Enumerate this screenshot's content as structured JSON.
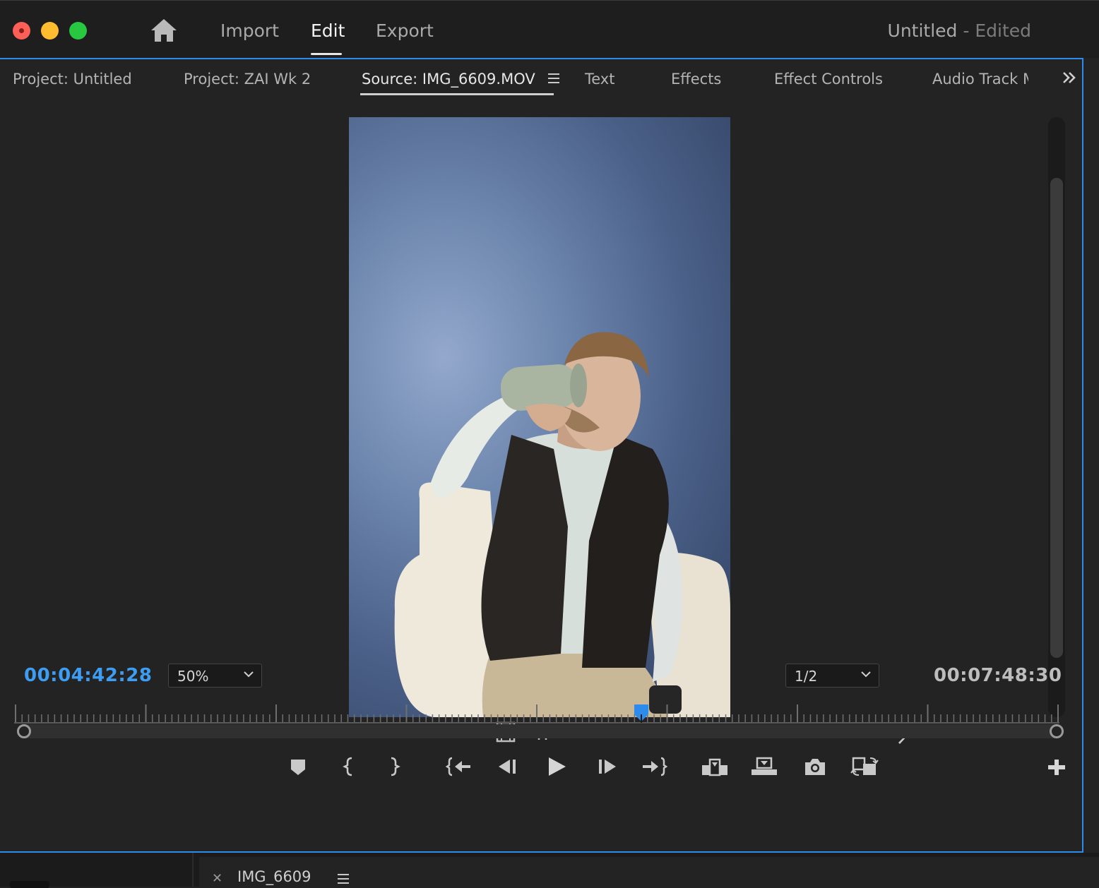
{
  "app": {
    "nav": {
      "import": "Import",
      "edit": "Edit",
      "export": "Export",
      "active": "Edit"
    },
    "document": {
      "name": "Untitled",
      "status": "- Edited"
    }
  },
  "panel": {
    "tabs": [
      {
        "label": "Project: Untitled"
      },
      {
        "label": "Project: ZAI Wk 2"
      },
      {
        "label": "Source: IMG_6609.MOV",
        "active": true
      },
      {
        "label": "Text"
      },
      {
        "label": "Effects"
      },
      {
        "label": "Effect Controls"
      },
      {
        "label": "Audio Track M"
      }
    ]
  },
  "source_monitor": {
    "current_timecode": "00:04:42:28",
    "duration_timecode": "00:07:48:30",
    "zoom": "50%",
    "resolution": "1/2",
    "playhead_progress": 0.6
  },
  "timeline": {
    "sequence_name": "IMG_6609"
  },
  "colors": {
    "accent": "#2d8ceb",
    "timecode": "#3d9df3",
    "background": "#232323"
  },
  "icons": {
    "home": "home-icon",
    "overflow": "double-chevron-right-icon",
    "drag_video": "film-strip-icon",
    "drag_audio": "audio-waveform-icon",
    "settings": "wrench-icon"
  }
}
